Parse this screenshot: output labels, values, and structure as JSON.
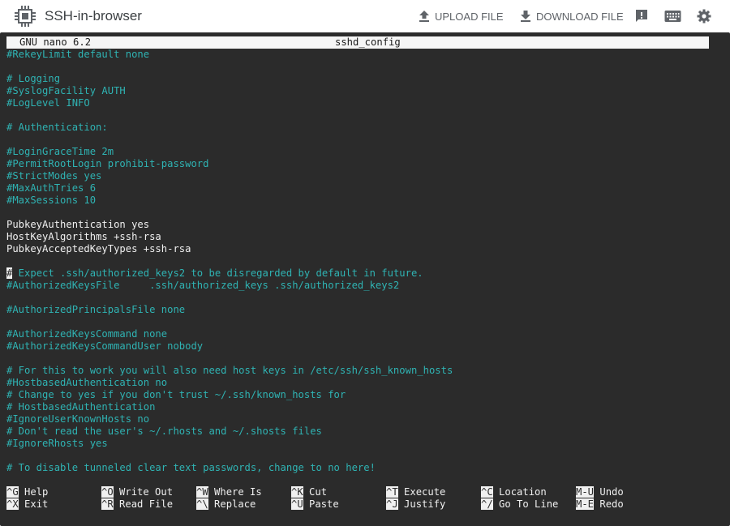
{
  "app": {
    "title": "SSH-in-browser"
  },
  "toolbar": {
    "upload_label": "UPLOAD FILE",
    "download_label": "DOWNLOAD FILE",
    "icons": [
      "feedback-icon",
      "keyboard-icon",
      "settings-icon"
    ]
  },
  "nano": {
    "version": "GNU nano 6.2",
    "filename": "sshd_config"
  },
  "editor_lines": [
    {
      "text": "#RekeyLimit default none",
      "style": "comment"
    },
    {
      "text": "",
      "style": "comment"
    },
    {
      "text": "# Logging",
      "style": "comment"
    },
    {
      "text": "#SyslogFacility AUTH",
      "style": "comment"
    },
    {
      "text": "#LogLevel INFO",
      "style": "comment"
    },
    {
      "text": "",
      "style": "comment"
    },
    {
      "text": "# Authentication:",
      "style": "comment"
    },
    {
      "text": "",
      "style": "comment"
    },
    {
      "text": "#LoginGraceTime 2m",
      "style": "comment"
    },
    {
      "text": "#PermitRootLogin prohibit-password",
      "style": "comment"
    },
    {
      "text": "#StrictModes yes",
      "style": "comment"
    },
    {
      "text": "#MaxAuthTries 6",
      "style": "comment"
    },
    {
      "text": "#MaxSessions 10",
      "style": "comment"
    },
    {
      "text": "",
      "style": "comment"
    },
    {
      "text": "PubkeyAuthentication yes",
      "style": "plain"
    },
    {
      "text": "HostKeyAlgorithms +ssh-rsa",
      "style": "plain"
    },
    {
      "text": "PubkeyAcceptedKeyTypes +ssh-rsa",
      "style": "plain"
    },
    {
      "text": "",
      "style": "comment"
    },
    {
      "text": "# Expect .ssh/authorized_keys2 to be disregarded by default in future.",
      "style": "cursor"
    },
    {
      "text": "#AuthorizedKeysFile     .ssh/authorized_keys .ssh/authorized_keys2",
      "style": "comment"
    },
    {
      "text": "",
      "style": "comment"
    },
    {
      "text": "#AuthorizedPrincipalsFile none",
      "style": "comment"
    },
    {
      "text": "",
      "style": "comment"
    },
    {
      "text": "#AuthorizedKeysCommand none",
      "style": "comment"
    },
    {
      "text": "#AuthorizedKeysCommandUser nobody",
      "style": "comment"
    },
    {
      "text": "",
      "style": "comment"
    },
    {
      "text": "# For this to work you will also need host keys in /etc/ssh/ssh_known_hosts",
      "style": "comment"
    },
    {
      "text": "#HostbasedAuthentication no",
      "style": "comment"
    },
    {
      "text": "# Change to yes if you don't trust ~/.ssh/known_hosts for",
      "style": "comment"
    },
    {
      "text": "# HostbasedAuthentication",
      "style": "comment"
    },
    {
      "text": "#IgnoreUserKnownHosts no",
      "style": "comment"
    },
    {
      "text": "# Don't read the user's ~/.rhosts and ~/.shosts files",
      "style": "comment"
    },
    {
      "text": "#IgnoreRhosts yes",
      "style": "comment"
    },
    {
      "text": "",
      "style": "comment"
    },
    {
      "text": "# To disable tunneled clear text passwords, change to no here!",
      "style": "comment"
    }
  ],
  "shortcuts": [
    [
      {
        "key": "^G",
        "label": "Help"
      },
      {
        "key": "^O",
        "label": "Write Out"
      },
      {
        "key": "^W",
        "label": "Where Is"
      },
      {
        "key": "^K",
        "label": "Cut"
      },
      {
        "key": "^T",
        "label": "Execute"
      },
      {
        "key": "^C",
        "label": "Location"
      },
      {
        "key": "M-U",
        "label": "Undo"
      }
    ],
    [
      {
        "key": "^X",
        "label": "Exit"
      },
      {
        "key": "^R",
        "label": "Read File"
      },
      {
        "key": "^\\",
        "label": "Replace"
      },
      {
        "key": "^U",
        "label": "Paste"
      },
      {
        "key": "^J",
        "label": "Justify"
      },
      {
        "key": "^/",
        "label": "Go To Line"
      },
      {
        "key": "M-E",
        "label": "Redo"
      }
    ]
  ],
  "colors": {
    "terminal_bg": "#2b2b2b",
    "comment": "#2fb3b3",
    "plain": "#f0f0f0",
    "toolbar_text": "#5f6368"
  }
}
